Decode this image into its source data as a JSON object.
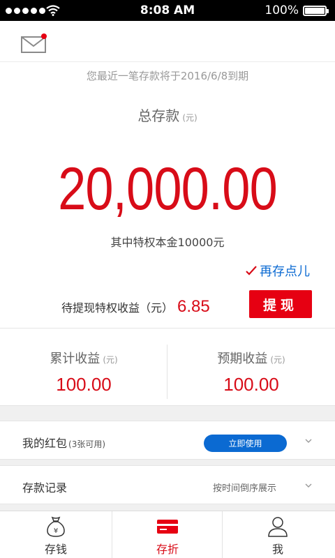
{
  "status_bar": {
    "time": "8:08 AM",
    "battery": "100%"
  },
  "header": {
    "mail_icon": "mail-icon"
  },
  "notice": "您最近一笔存款将于2016/6/8到期",
  "total": {
    "title": "总存款",
    "unit": "(元)",
    "amount": "20,000.00",
    "principal_note": "其中特权本金10000元"
  },
  "deposit_more_label": "再存点儿",
  "pending": {
    "label": "待提现特权收益（元）",
    "value": "6.85",
    "button": "提现"
  },
  "stats": {
    "cumulative": {
      "label": "累计收益",
      "unit": "(元)",
      "value": "100.00"
    },
    "expected": {
      "label": "预期收益",
      "unit": "(元)",
      "value": "100.00"
    }
  },
  "red_packet": {
    "title": "我的红包",
    "sub": "(3张可用)",
    "button": "立即使用"
  },
  "records": {
    "title": "存款记录",
    "hint": "按时间倒序展示"
  },
  "tabs": [
    {
      "label": "存钱",
      "icon": "money-bag-icon",
      "active": false
    },
    {
      "label": "存折",
      "icon": "bankbook-icon",
      "active": true
    },
    {
      "label": "我",
      "icon": "user-icon",
      "active": false
    }
  ],
  "colors": {
    "accent_red": "#e60012",
    "amount_red": "#d80c18",
    "link_blue": "#0b6ad2"
  }
}
